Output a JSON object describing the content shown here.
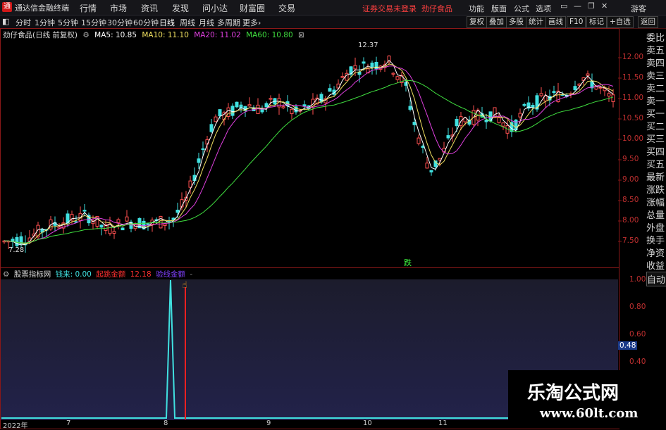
{
  "window": {
    "app_name": "通达信金融终端",
    "menus": [
      "行情",
      "市场",
      "资讯",
      "发现",
      "问小达",
      "财富圈",
      "交易"
    ],
    "status_text": "证券交易未登录",
    "stock_title": "劲仔食品",
    "right_menus": [
      "功能",
      "版面",
      "公式",
      "选项"
    ],
    "user": "游客"
  },
  "toolbar": {
    "periods": [
      "分时",
      "1分钟",
      "5分钟",
      "15分钟",
      "30分钟",
      "60分钟",
      "日线",
      "周线",
      "月线",
      "多周期",
      "更多"
    ],
    "active_period": "日线",
    "right_buttons": [
      "复权",
      "叠加",
      "多股",
      "统计",
      "画线",
      "F10",
      "标记",
      "+自选",
      "返回"
    ]
  },
  "main_chart": {
    "stock_label": "劲仔食品(日线 前复权)",
    "ma_values": [
      {
        "label": "MA5: 10.85",
        "color": "#ffffff"
      },
      {
        "label": "MA10: 11.10",
        "color": "#f0e060"
      },
      {
        "label": "MA20: 11.02",
        "color": "#e040e0"
      },
      {
        "label": "MA60: 10.80",
        "color": "#40e040"
      }
    ],
    "price_ticks": [
      "12.00",
      "11.50",
      "11.00",
      "10.50",
      "10.00",
      "9.50",
      "9.00",
      "8.50",
      "8.00",
      "7.50"
    ],
    "high_label": "12.37",
    "low_label": "7.28",
    "marker_text": "跌"
  },
  "side_panel": {
    "items": [
      "委比",
      "卖五",
      "卖四",
      "卖三",
      "卖二",
      "卖一",
      "买一",
      "买二",
      "买三",
      "买四",
      "买五",
      "最新",
      "涨跌",
      "涨幅",
      "总量",
      "外盘",
      "换手",
      "净资",
      "收益"
    ],
    "auto_button": "自动"
  },
  "indicator": {
    "name": "股票指标网",
    "items": [
      {
        "label": "钱来: 0.00",
        "color": "#40e0e0"
      },
      {
        "label": "起跳金额",
        "color": "#ff3030"
      },
      {
        "label": "12.18",
        "color": "#ff3030"
      },
      {
        "label": "验线金额",
        "color": "#8040ff"
      }
    ],
    "ticks": [
      "1.00",
      "0.80",
      "0.60",
      "0.40"
    ],
    "current_value": "0.48"
  },
  "x_axis": [
    "2022年",
    "7",
    "8",
    "9",
    "10",
    "11"
  ],
  "watermark": {
    "line1": "乐淘公式网",
    "line2": "www.60lt.com"
  },
  "colors": {
    "up": "#ff5050",
    "down": "#40e0e0",
    "border": "#8a1818",
    "accent": "#ff3030"
  }
}
